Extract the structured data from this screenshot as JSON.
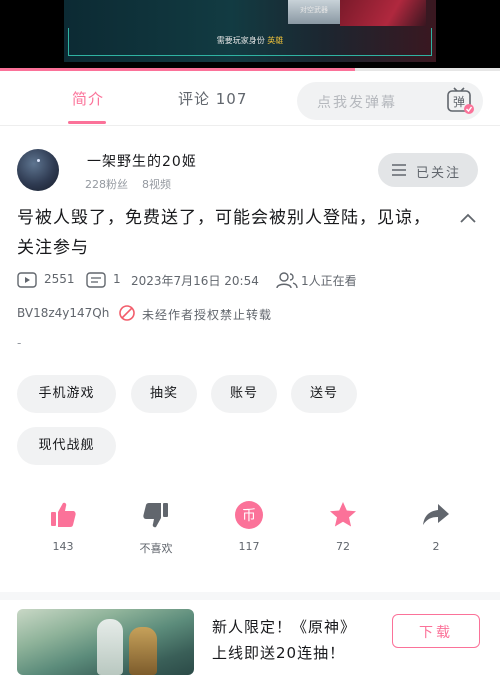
{
  "video": {
    "caption_prefix": "需要玩家身份",
    "caption_highlight": "英雄",
    "small_text_right": "对空武器",
    "progress_fraction": 0.71
  },
  "tabs": {
    "intro": "简介",
    "comments": "评论 107",
    "danmaku_placeholder": "点我发弹幕",
    "danmaku_button": "弹"
  },
  "author": {
    "name": "一架野生的20姬",
    "followers": "228粉丝",
    "videos": "8视频",
    "follow_label": "已关注"
  },
  "video_info": {
    "title": "号被人毁了，免费送了，可能会被别人登陆，见谅，关注参与",
    "views": "2551",
    "danmaku_count": "1",
    "date": "2023年7月16日 20:54",
    "watching": "1人正在看",
    "bvid": "BV18z4y147Qh",
    "notice": "未经作者授权禁止转载",
    "desc": "-"
  },
  "tags": [
    "手机游戏",
    "抽奖",
    "账号",
    "送号",
    "现代战舰"
  ],
  "actions": {
    "like": "143",
    "dislike": "不喜欢",
    "coin": "117",
    "coin_glyph": "币",
    "favorite": "72",
    "share": "2"
  },
  "ad": {
    "line1": "新人限定！《原神》",
    "line2": "上线即送20连抽！",
    "button": "下载"
  },
  "colors": {
    "accent": "#fb7299",
    "text": "#18191c",
    "muted": "#61666d"
  }
}
